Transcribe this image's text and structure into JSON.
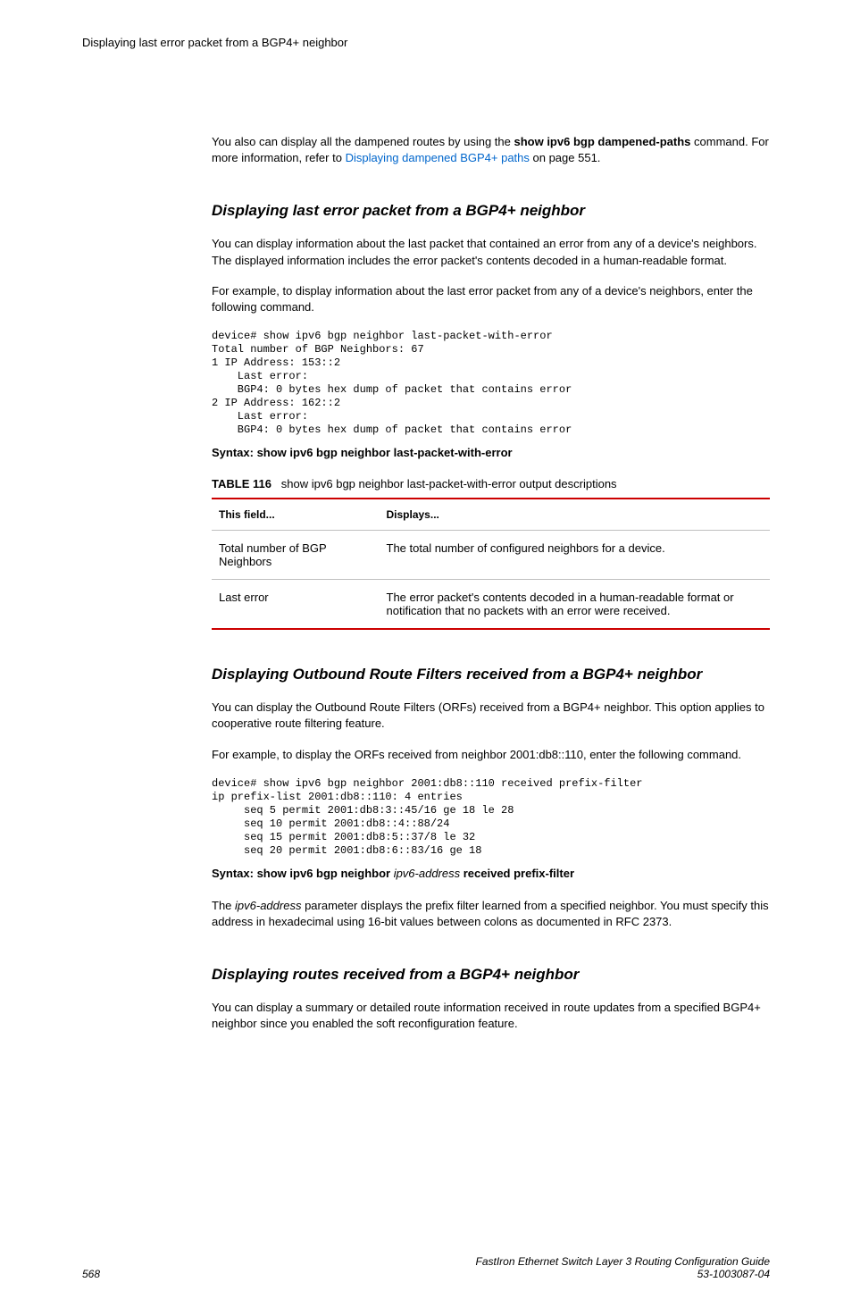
{
  "header": {
    "title": "Displaying last error packet from a BGP4+ neighbor"
  },
  "intro": {
    "para1_pre": "You also can display all the dampened routes by using the ",
    "para1_bold": "show ipv6 bgp dampened-paths",
    "para1_mid": " command. For more information, refer to ",
    "para1_link": "Displaying dampened BGP4+ paths",
    "para1_post": " on page 551."
  },
  "section1": {
    "heading": "Displaying last error packet from a BGP4+ neighbor",
    "para1": "You can display information about the last packet that contained an error from any of a device's neighbors. The displayed information includes the error packet's contents decoded in a human-readable format.",
    "para2": "For example, to display information about the last error packet from any of a device's neighbors, enter the following command.",
    "cli": "device# show ipv6 bgp neighbor last-packet-with-error\nTotal number of BGP Neighbors: 67\n1 IP Address: 153::2\n    Last error:\n    BGP4: 0 bytes hex dump of packet that contains error\n2 IP Address: 162::2\n    Last error:\n    BGP4: 0 bytes hex dump of packet that contains error",
    "syntax_label": "Syntax: show ipv6 bgp neighbor last-packet-with-error",
    "table_caption_label": "TABLE 116",
    "table_caption_text": "show ipv6 bgp neighbor last-packet-with-error output descriptions",
    "table": {
      "header_field": "This field...",
      "header_displays": "Displays...",
      "rows": [
        {
          "field": "Total number of BGP Neighbors",
          "displays": "The total number of configured neighbors for a device."
        },
        {
          "field": "Last error",
          "displays": "The error packet's contents decoded in a human-readable format or notification that no packets with an error were received."
        }
      ]
    }
  },
  "section2": {
    "heading": "Displaying Outbound Route Filters received from a BGP4+ neighbor",
    "para1": "You can display the Outbound Route Filters (ORFs) received from a BGP4+ neighbor. This option applies to cooperative route filtering feature.",
    "para2": "For example, to display the ORFs received from neighbor 2001:db8::110, enter the following command.",
    "cli": "device# show ipv6 bgp neighbor 2001:db8::110 received prefix-filter\nip prefix-list 2001:db8::110: 4 entries\n     seq 5 permit 2001:db8:3::45/16 ge 18 le 28\n     seq 10 permit 2001:db8::4::88/24\n     seq 15 permit 2001:db8:5::37/8 le 32\n     seq 20 permit 2001:db8:6::83/16 ge 18",
    "syntax_pre": "Syntax: show ipv6 bgp neighbor",
    "syntax_italic": " ipv6-address ",
    "syntax_post": "received prefix-filter",
    "para3_pre": "The ",
    "para3_italic": "ipv6-address",
    "para3_post": " parameter displays the prefix filter learned from a specified neighbor. You must specify this address in hexadecimal using 16-bit values between colons as documented in RFC 2373."
  },
  "section3": {
    "heading": "Displaying routes received from a BGP4+ neighbor",
    "para1": "You can display a summary or detailed route information received in route updates from a specified BGP4+ neighbor since you enabled the soft reconfiguration feature."
  },
  "footer": {
    "page": "568",
    "guide": "FastIron Ethernet Switch Layer 3 Routing Configuration Guide",
    "docnum": "53-1003087-04"
  }
}
